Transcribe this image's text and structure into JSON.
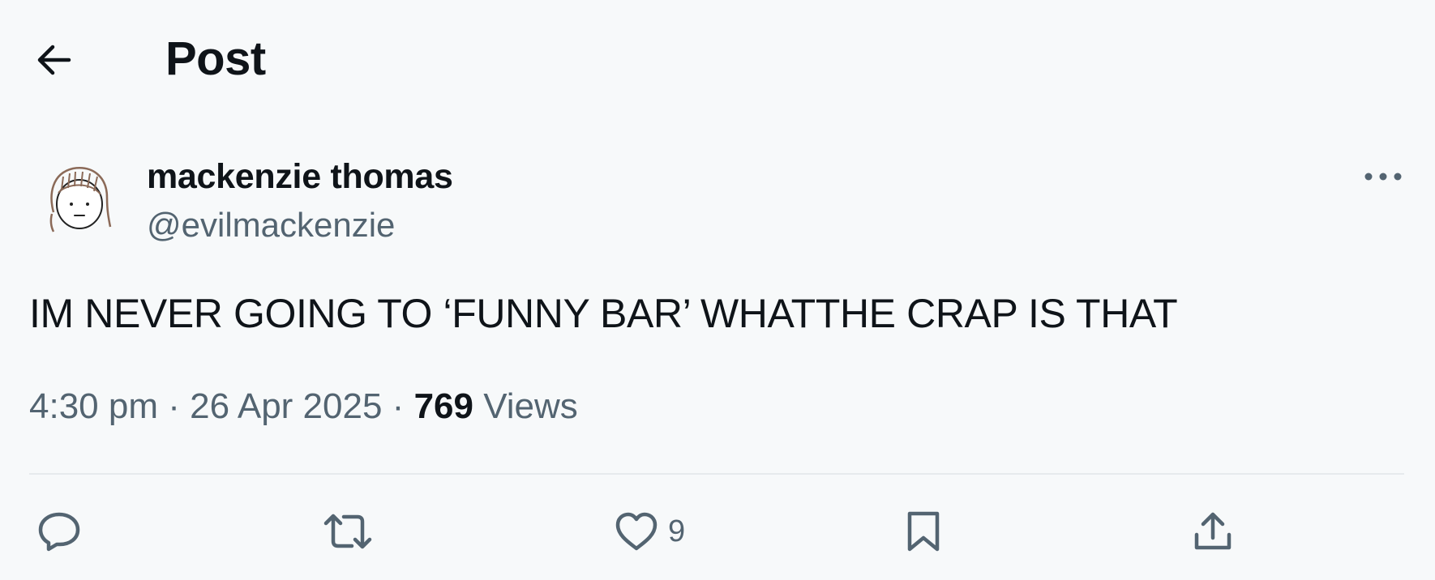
{
  "header": {
    "title": "Post",
    "back_icon": "arrow-left-icon"
  },
  "author": {
    "name": "mackenzie thomas",
    "handle": "@evilmackenzie",
    "avatar_icon": "hand-drawn-face-avatar",
    "more_icon": "ellipsis-icon"
  },
  "post": {
    "text": "IM NEVER GOING TO ‘FUNNY BAR’ WHATTHE CRAP IS THAT",
    "time": "4:30 pm",
    "separator": "·",
    "date": "26 Apr 2025",
    "views_count": "769",
    "views_label": "Views"
  },
  "actions": {
    "reply_icon": "reply-bubble-icon",
    "repost_icon": "repost-icon",
    "like_icon": "heart-icon",
    "like_count": "9",
    "bookmark_icon": "bookmark-icon",
    "share_icon": "share-upload-icon"
  },
  "colors": {
    "background": "#f7f9fa",
    "text_primary": "#0f1419",
    "text_secondary": "#536471",
    "divider": "#e6eaed"
  }
}
